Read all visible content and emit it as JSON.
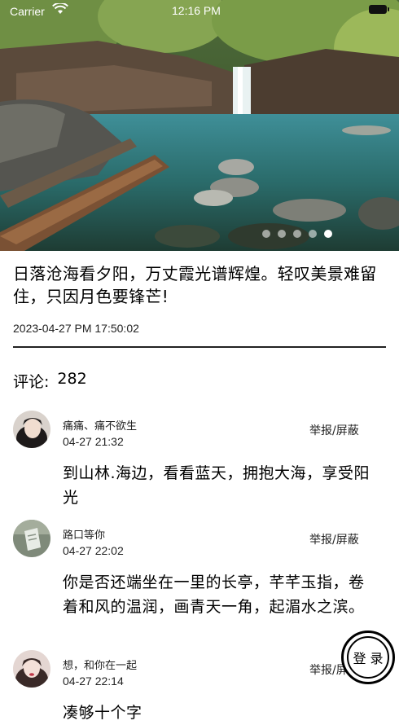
{
  "status_bar": {
    "carrier": "Carrier",
    "time": "12:16 PM"
  },
  "banner": {
    "page_count": 5,
    "active_page": 5
  },
  "post": {
    "text": "日落沧海看夕阳，万丈霞光谱辉煌。轻叹美景难留住，只因月色要锋芒!",
    "timestamp": "2023-04-27 PM 17:50:02"
  },
  "comments_header": {
    "label": "评论:",
    "count": "282"
  },
  "comments": [
    {
      "name": "痛痛、痛不欲生",
      "date": "04-27 21:32",
      "report": "举报/屏蔽",
      "text": "到山林.海边，看看蓝天，拥抱大海，享受阳光"
    },
    {
      "name": "路口等你",
      "date": "04-27 22:02",
      "report": "举报/屏蔽",
      "text": "你是否还端坐在一里的长亭，芊芊玉指，卷着和风的温润，画青天一角，起湄水之滨。"
    },
    {
      "name": "想，和你在一起",
      "date": "04-27 22:14",
      "report": "举报/屏蔽",
      "text": "凑够十个字"
    }
  ],
  "login_button": {
    "label": "登 录"
  },
  "colors": {
    "text": "#000000",
    "background": "#ffffff",
    "divider": "#222222"
  }
}
